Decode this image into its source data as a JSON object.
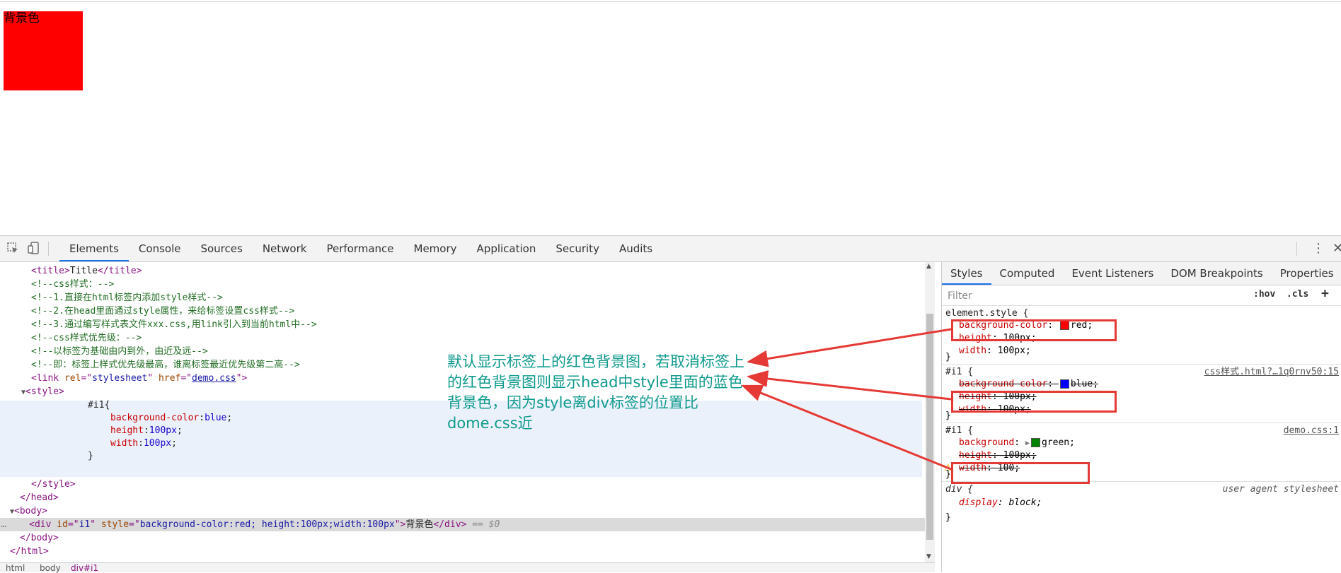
{
  "page": {
    "div_text": "背景色"
  },
  "toolbar": {
    "tabs": [
      "Elements",
      "Console",
      "Sources",
      "Network",
      "Performance",
      "Memory",
      "Application",
      "Security",
      "Audits"
    ],
    "active_tab": "Elements"
  },
  "elements": {
    "lines": {
      "title_text": "Title",
      "c1": "<!--css样式：-->",
      "c2": "<!--1.直接在html标签内添加style样式-->",
      "c3": "<!--2.在head里面通过style属性，来给标签设置css样式-->",
      "c4": "<!--3.通过编写样式表文件xxx.css,用link引入到当前html中-->",
      "c5": "<!--css样式优先级：-->",
      "c6": "<!--以标签为基础由内到外，由近及远-->",
      "c7": "<!--即：标签上样式优先级最高，谁离标签最近优先级第二高-->",
      "link_rel": "stylesheet",
      "link_href": "demo.css",
      "selector": "#i1{",
      "prop1": "background-color",
      "val1": "blue",
      "prop2": "height",
      "val2": "100px",
      "prop3": "width",
      "val3": "100px",
      "close_brace": "}",
      "div_id": "i1",
      "div_style": "background-color:red; height:100px;width:100px",
      "div_text": "背景色",
      "dollar": "== $0"
    },
    "breadcrumb": [
      "html",
      "body",
      "div#i1"
    ]
  },
  "styles": {
    "tabs": [
      "Styles",
      "Computed",
      "Event Listeners",
      "DOM Breakpoints",
      "Properties"
    ],
    "active_tab": "Styles",
    "filter_placeholder": "Filter",
    "hov": ":hov",
    ".cls": ".cls",
    "rules": {
      "element": {
        "selector": "element.style {",
        "p1": "background-color",
        "v1": "red",
        "p2": "height",
        "v2": "100px",
        "p3": "width",
        "v3": "100px"
      },
      "head": {
        "selector": "#i1 {",
        "source": "css样式.html?…1q0rnv50:15",
        "p1": "background-color",
        "v1": "blue",
        "p2": "height",
        "v2": "100px",
        "p3": "width",
        "v3": "100px"
      },
      "democss": {
        "selector": "#i1 {",
        "source": "demo.css:1",
        "p1": "background",
        "v1": "green",
        "p2": "height",
        "v2": "100px",
        "p3": "width",
        "v3": "100"
      },
      "ua": {
        "selector": "div {",
        "source": "user agent stylesheet",
        "p1": "display",
        "v1": "block"
      }
    },
    "colors": {
      "red": "#ff0000",
      "blue": "#0000ff",
      "green": "#008000"
    }
  },
  "annotation": {
    "text": "默认显示标签上的红色背景图，若取消标签上的红色背景图则显示head中style里面的蓝色背景色，因为style离div标签的位置比dome.css近"
  }
}
